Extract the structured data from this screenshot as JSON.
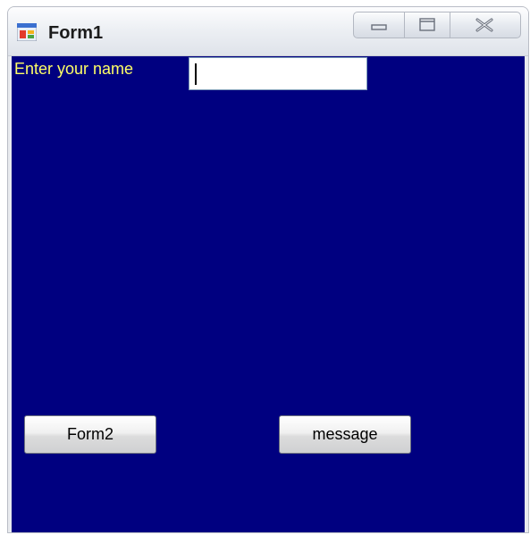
{
  "window": {
    "title": "Form1",
    "icon": "windows-form-icon"
  },
  "caption_buttons": {
    "minimize_icon": "minimize-icon",
    "maximize_icon": "maximize-icon",
    "close_icon": "close-icon"
  },
  "form": {
    "background": "#000080",
    "label_color": "#ffff66",
    "name_label": "Enter your name",
    "name_input_value": "",
    "form2_button": "Form2",
    "message_button": "message"
  }
}
